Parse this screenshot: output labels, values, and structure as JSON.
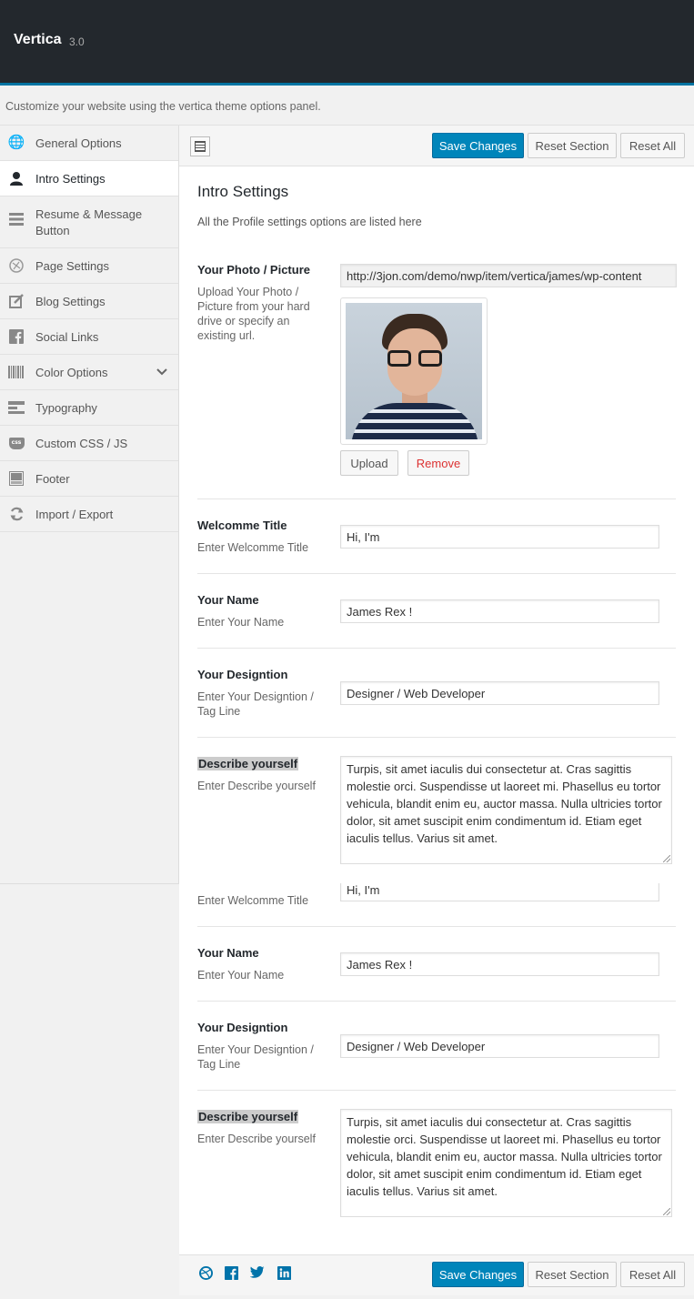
{
  "app": {
    "name": "Vertica",
    "version": "3.0",
    "tagline": "Customize your website using the vertica theme options panel."
  },
  "sidebar": {
    "items": [
      {
        "label": "General Options",
        "icon": "globe-icon"
      },
      {
        "label": "Intro Settings",
        "icon": "user-icon",
        "active": true
      },
      {
        "label": "Resume & Message Button",
        "icon": "list-icon"
      },
      {
        "label": "Page Settings",
        "icon": "page-icon"
      },
      {
        "label": "Blog Settings",
        "icon": "edit-icon"
      },
      {
        "label": "Social Links",
        "icon": "facebook-icon"
      },
      {
        "label": "Color Options",
        "icon": "barcode-icon",
        "expandable": true
      },
      {
        "label": "Typography",
        "icon": "typography-icon"
      },
      {
        "label": "Custom CSS / JS",
        "icon": "css-icon",
        "icon_text": "css"
      },
      {
        "label": "Footer",
        "icon": "footer-icon"
      },
      {
        "label": "Import / Export",
        "icon": "refresh-icon"
      }
    ]
  },
  "toolbar": {
    "save_label": "Save Changes",
    "reset_section_label": "Reset Section",
    "reset_all_label": "Reset All"
  },
  "section": {
    "title": "Intro Settings",
    "desc": "All the Profile settings options are listed here"
  },
  "photo": {
    "label": "Your Photo / Picture",
    "desc": "Upload Your Photo / Picture from your hard drive or specify an existing url.",
    "url": "http://3jon.com/demo/nwp/item/vertica/james/wp-content",
    "upload_label": "Upload",
    "remove_label": "Remove"
  },
  "fields": {
    "welcome_title": {
      "label": "Welcomme Title",
      "desc": "Enter Welcomme Title",
      "value": "Hi, I'm"
    },
    "name": {
      "label": "Your Name",
      "desc": "Enter Your Name",
      "value": "James Rex !"
    },
    "designation": {
      "label": "Your Designtion",
      "desc": "Enter Your Designtion / Tag Line",
      "value": "Designer / Web Developer"
    },
    "describe": {
      "label": "Describe yourself",
      "desc": "Enter Describe yourself",
      "value": "Turpis, sit amet iaculis dui consectetur at. Cras sagittis molestie orci. Suspendisse ut laoreet mi. Phasellus eu tortor vehicula, blandit enim eu, auctor massa. Nulla ultricies tortor dolor, sit amet suscipit enim condimentum id. Etiam eget iaculis tellus. Varius sit amet."
    }
  },
  "social": [
    "dribbble-icon",
    "facebook-icon",
    "twitter-icon",
    "linkedin-icon"
  ],
  "colors": {
    "topbar": "#23282d",
    "accent": "#0085ba",
    "remove": "#dc3232"
  }
}
